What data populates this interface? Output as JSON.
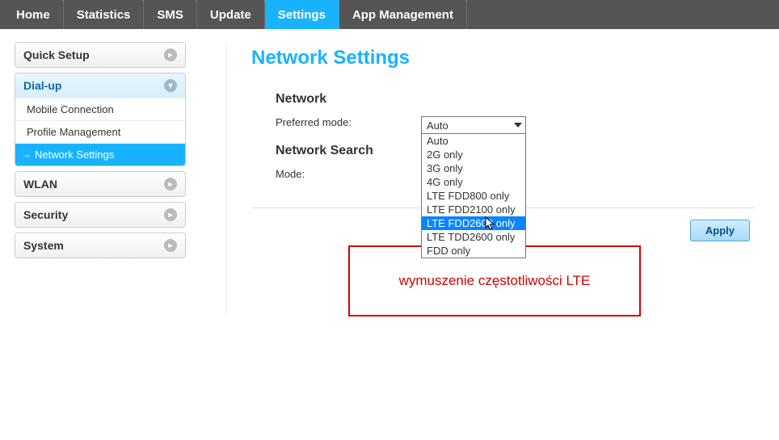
{
  "nav": {
    "items": [
      {
        "label": "Home",
        "active": false
      },
      {
        "label": "Statistics",
        "active": false
      },
      {
        "label": "SMS",
        "active": false
      },
      {
        "label": "Update",
        "active": false
      },
      {
        "label": "Settings",
        "active": true
      },
      {
        "label": "App Management",
        "active": false
      }
    ]
  },
  "sidebar": {
    "groups": [
      {
        "label": "Quick Setup",
        "expanded": false,
        "items": []
      },
      {
        "label": "Dial-up",
        "expanded": true,
        "items": [
          {
            "label": "Mobile Connection",
            "active": false
          },
          {
            "label": "Profile Management",
            "active": false
          },
          {
            "label": "Network Settings",
            "active": true
          }
        ]
      },
      {
        "label": "WLAN",
        "expanded": false,
        "items": []
      },
      {
        "label": "Security",
        "expanded": false,
        "items": []
      },
      {
        "label": "System",
        "expanded": false,
        "items": []
      }
    ]
  },
  "page": {
    "title": "Network Settings",
    "section_network": "Network",
    "preferred_mode_label": "Preferred mode:",
    "preferred_mode_value": "Auto",
    "preferred_mode_options": [
      "Auto",
      "2G only",
      "3G only",
      "4G only",
      "LTE FDD800 only",
      "LTE FDD2100 only",
      "LTE FDD2600 only",
      "LTE TDD2600 only",
      "FDD only"
    ],
    "preferred_mode_highlight_index": 6,
    "section_search": "Network Search",
    "mode_label": "Mode:",
    "apply_label": "Apply"
  },
  "annotation": {
    "text": "wymuszenie częstotliwości LTE"
  }
}
